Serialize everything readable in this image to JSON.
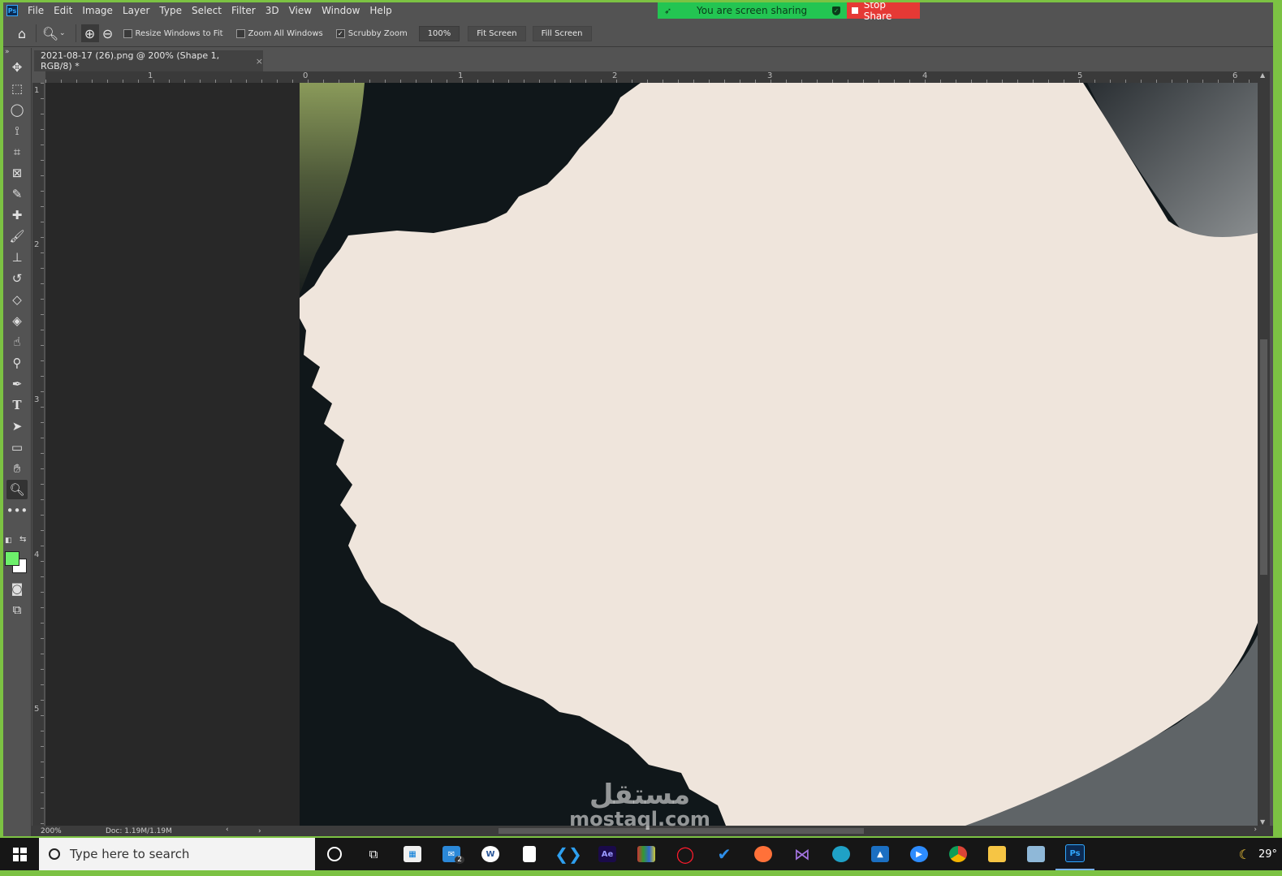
{
  "app": {
    "logo": "Ps"
  },
  "menu": [
    "File",
    "Edit",
    "Image",
    "Layer",
    "Type",
    "Select",
    "Filter",
    "3D",
    "View",
    "Window",
    "Help"
  ],
  "share": {
    "message": "You are screen sharing",
    "stop_label": "Stop Share"
  },
  "options": {
    "resize_label": "Resize Windows to Fit",
    "zoom_all_label": "Zoom All Windows",
    "scrubby_label": "Scrubby Zoom",
    "zoom_value": "100%",
    "fit_label": "Fit Screen",
    "fill_label": "Fill Screen"
  },
  "document_tab": {
    "title": "2021-08-17 (26).png @ 200% (Shape 1, RGB/8) *",
    "close": "×"
  },
  "rulers": {
    "horizontal": [
      "1",
      "0",
      "1",
      "2",
      "3",
      "4",
      "5",
      "6"
    ],
    "vertical": [
      "1",
      "2",
      "3",
      "4",
      "5"
    ]
  },
  "status": {
    "zoom": "200%",
    "doc": "Doc: 1.19M/1.19M"
  },
  "taskbar": {
    "search_placeholder": "Type here to search",
    "mail_badge": "2",
    "temperature": "29°"
  },
  "watermark": {
    "arabic": "مستقل",
    "latin": "mostaql.com"
  },
  "colors": {
    "foreground": "#6df06b",
    "background": "#ffffff",
    "canvas_fill": "#efe5dc",
    "share_green": "#23c552",
    "share_red": "#e53935"
  }
}
